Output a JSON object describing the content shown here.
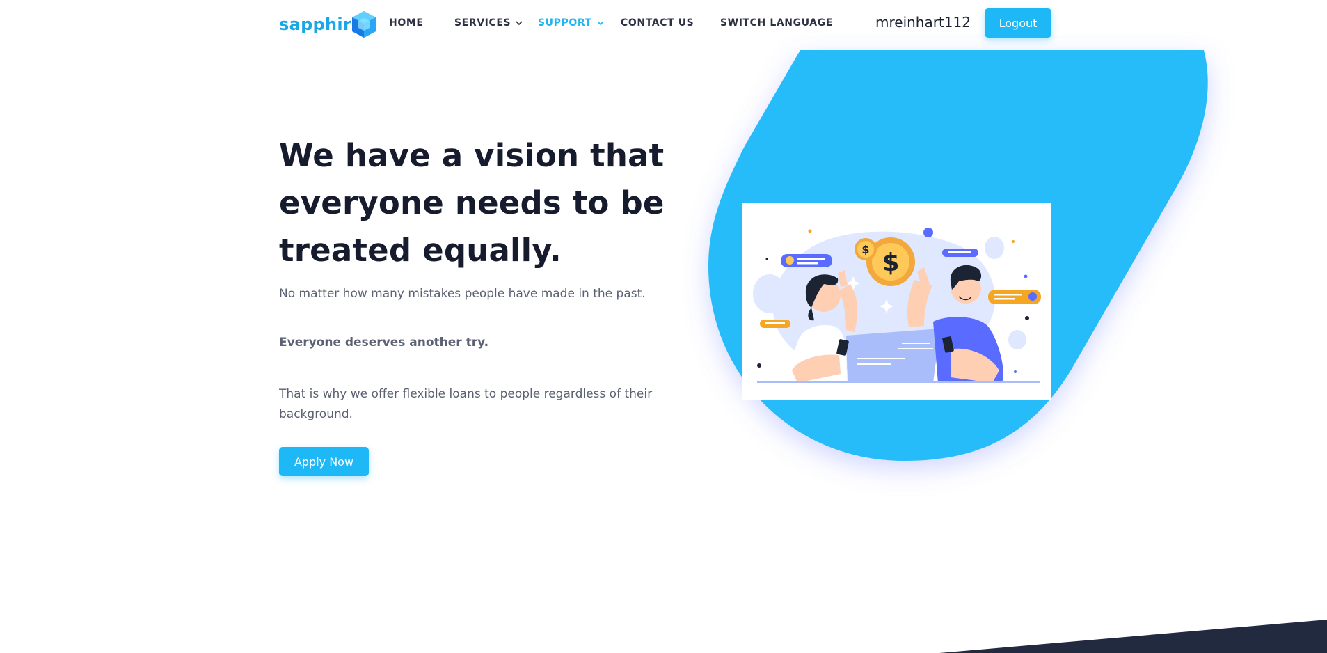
{
  "brand": {
    "name": "sapphir",
    "accent": "#1fb8f7",
    "logo_icon": "hexagon-gem-icon"
  },
  "nav": {
    "home": "HOME",
    "services": "SERVICES",
    "support": "SUPPORT",
    "contact": "CONTACT US",
    "language": "SWITCH LANGUAGE"
  },
  "user": {
    "name": "mreinhart112",
    "logout_label": "Logout"
  },
  "hero": {
    "title": "We have a vision that everyone needs to be treated equally.",
    "p1": "No matter how many mistakes people have made in the past.",
    "p2": "Everyone deserves another try.",
    "p3": "That is why we offer flexible loans to people regardless of their background.",
    "cta_label": "Apply Now"
  },
  "colors": {
    "blob": "#28bcf9",
    "dark_footer": "#222a40",
    "nav_active": "#1fb3f5"
  },
  "illustration": {
    "currency_symbol": "$"
  }
}
